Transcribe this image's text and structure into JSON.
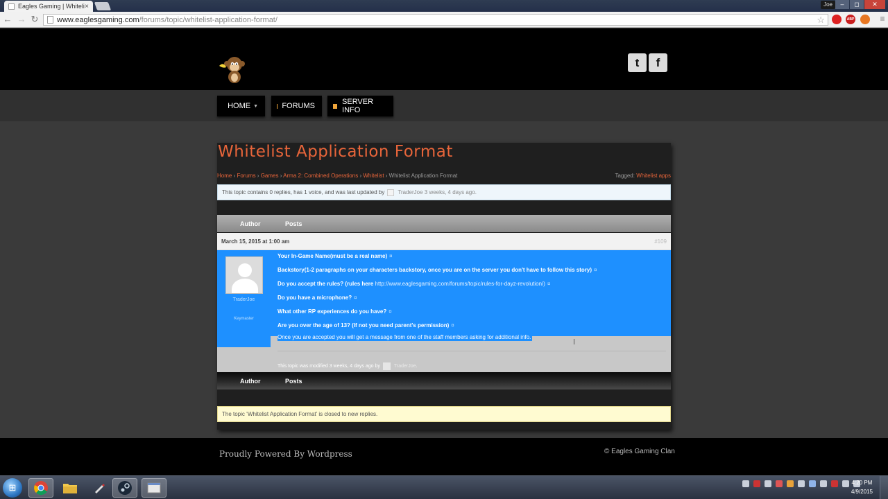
{
  "browser": {
    "tab_title": "Eagles Gaming | Whitelist",
    "tab_close": "×",
    "user_chip": "Joe",
    "window_buttons": [
      "–",
      "◻",
      "✕"
    ],
    "url_domain": "www.eaglesgaming.com",
    "url_path": "/forums/topic/whitelist-application-format/",
    "extension_labels": [
      "ABP"
    ]
  },
  "header": {
    "social": [
      "t",
      "f"
    ]
  },
  "nav": {
    "items": [
      {
        "label": "HOME",
        "has_dropdown": true,
        "caret": "▼"
      },
      {
        "label": "FORUMS",
        "has_dropdown": false
      },
      {
        "label": "SERVER INFO",
        "has_dropdown": false
      }
    ]
  },
  "topic": {
    "title": "Whitelist Application Format",
    "breadcrumb": [
      "Home",
      "Forums",
      "Games",
      "Arma 2: Combined Operations",
      "Whitelist"
    ],
    "breadcrumb_current": "Whitelist Application Format",
    "breadcrumb_sep": " › ",
    "tagged_label": "Tagged: ",
    "tag": "Whitelist apps",
    "info_text": "This topic contains 0 replies, has 1 voice, and was last updated by",
    "info_user": "TraderJoe",
    "info_time": "3 weeks, 4 days ago."
  },
  "table_header": {
    "author": "Author",
    "posts": "Posts"
  },
  "post": {
    "date": "March 15, 2015 at 1:00 am",
    "permalink": "#109",
    "author_name": "TraderJoe",
    "author_role": "Keymaster",
    "pilcrow": "¤",
    "lines": [
      {
        "text": "Your In-Game Name(must be a real name)"
      },
      {
        "text": "Backstory(1-2 paragraphs on your characters backstory, once you are on the server you don't have to follow this story)"
      },
      {
        "text": "Do you accept the rules? (rules here",
        "url": "http://www.eaglesgaming.com/forums/topic/rules-for-dayz-revolution/",
        "suffix": ")"
      },
      {
        "text": "Do you have a microphone?"
      },
      {
        "text": "What other RP experiences do you have?"
      },
      {
        "text": "Are you over the age of 13? (If not you need parent's permission)"
      }
    ],
    "last_line": "Once you are accepted you will get a message from one of the staff members asking for additional info.",
    "modified_text": "This topic was modified 3 weeks, 4 days ago by",
    "modified_user": "TraderJoe",
    "modified_end": "."
  },
  "closed_notice": "The topic ‘Whitelist Application Format’ is closed to new replies.",
  "footer": {
    "powered": "Proudly Powered By Wordpress",
    "copyright": "© Eagles Gaming Clan"
  },
  "taskbar": {
    "start_glyph": "⊞",
    "time": "4:20 PM",
    "date": "4/9/2015"
  },
  "colors": {
    "accent": "#e8653a",
    "nav_square": "#f0a53a",
    "selection": "#1e90ff"
  }
}
